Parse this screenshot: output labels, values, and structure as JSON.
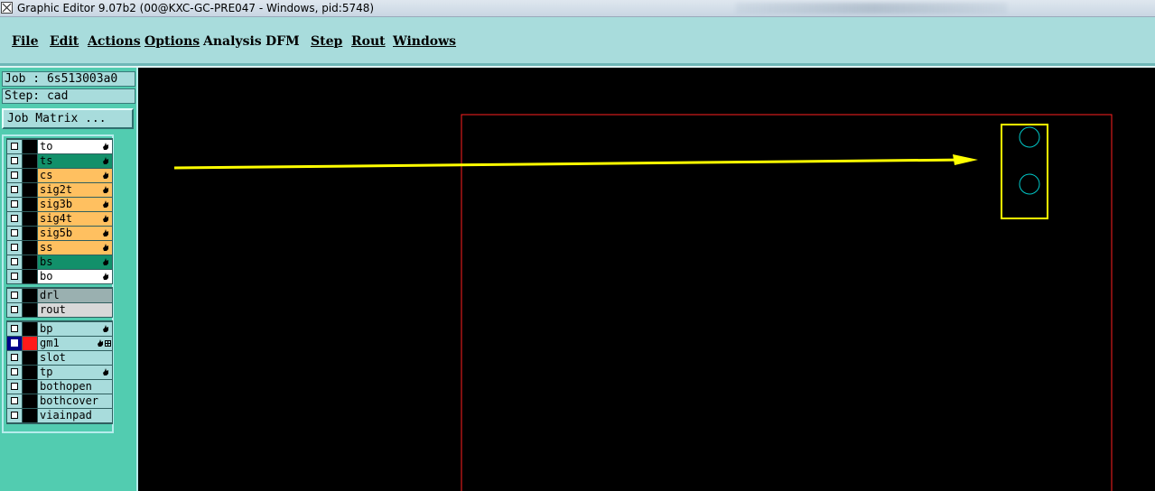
{
  "window": {
    "title": "Graphic Editor 9.07b2 (00@KXC-GC-PRE047 - Windows, pid:5748)"
  },
  "menu": [
    {
      "label": "File"
    },
    {
      "label": "Edit"
    },
    {
      "label": "Actions"
    },
    {
      "label": "Options"
    },
    {
      "label": "Analysis"
    },
    {
      "label": "DFM"
    },
    {
      "label": "Step"
    },
    {
      "label": "Rout"
    },
    {
      "label": "Windows"
    }
  ],
  "job": {
    "job_label": "Job : 6s513003a0",
    "step_label": "Step: cad",
    "matrix_button": "Job Matrix ..."
  },
  "layer_groups": [
    {
      "layers": [
        {
          "name": "to",
          "bg": "#ffffff",
          "fg": "#000000",
          "hand": true
        },
        {
          "name": "ts",
          "bg": "#12906a",
          "fg": "#000000",
          "hand": true
        },
        {
          "name": "cs",
          "bg": "#ffc060",
          "fg": "#000000",
          "hand": true
        },
        {
          "name": "sig2t",
          "bg": "#ffc060",
          "fg": "#000000",
          "hand": true
        },
        {
          "name": "sig3b",
          "bg": "#ffc060",
          "fg": "#000000",
          "hand": true
        },
        {
          "name": "sig4t",
          "bg": "#ffc060",
          "fg": "#000000",
          "hand": true
        },
        {
          "name": "sig5b",
          "bg": "#ffc060",
          "fg": "#000000",
          "hand": true
        },
        {
          "name": "ss",
          "bg": "#ffc060",
          "fg": "#000000",
          "hand": true
        },
        {
          "name": "bs",
          "bg": "#12906a",
          "fg": "#000000",
          "hand": true
        },
        {
          "name": "bo",
          "bg": "#ffffff",
          "fg": "#000000",
          "hand": true
        }
      ]
    },
    {
      "layers": [
        {
          "name": "drl",
          "bg": "#9ab0b0",
          "fg": "#000000",
          "hand": false
        },
        {
          "name": "rout",
          "bg": "#d8d8d8",
          "fg": "#000000",
          "hand": false
        }
      ]
    },
    {
      "layers": [
        {
          "name": "bp",
          "bg": "#a8dcdc",
          "fg": "#000000",
          "hand": true
        },
        {
          "name": "gm1",
          "bg": "#a8dcdc",
          "fg": "#000000",
          "hand": true,
          "selected": true,
          "color": "#ff1a1a"
        },
        {
          "name": "slot",
          "bg": "#a8dcdc",
          "fg": "#000000",
          "hand": false
        },
        {
          "name": "tp",
          "bg": "#a8dcdc",
          "fg": "#000000",
          "hand": true
        },
        {
          "name": "bothopen",
          "bg": "#a8dcdc",
          "fg": "#000000",
          "hand": false
        },
        {
          "name": "bothcover",
          "bg": "#a8dcdc",
          "fg": "#000000",
          "hand": false
        },
        {
          "name": "viainpad",
          "bg": "#a8dcdc",
          "fg": "#000000",
          "hand": false
        }
      ]
    }
  ],
  "colors": {
    "menu_bg": "#a8dcdc",
    "panel_bg": "#52ccb0",
    "canvas_bg": "#000000",
    "profile_outline": "#ff2020",
    "annotation_arrow": "#ffff00",
    "pad_circle": "#00c8c8"
  }
}
